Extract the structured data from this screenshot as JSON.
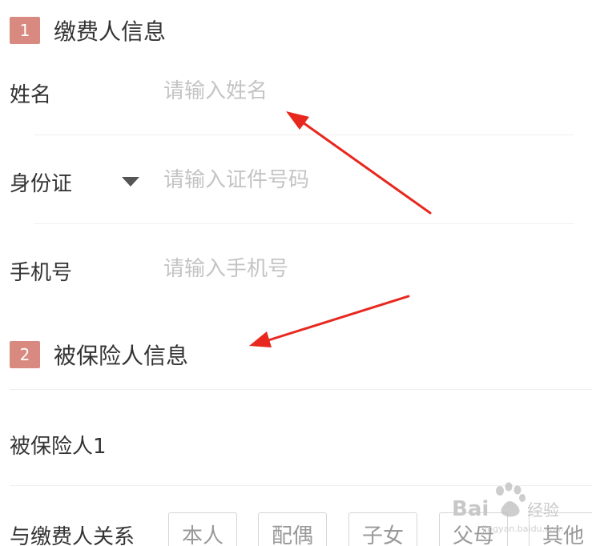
{
  "payer_section": {
    "number": "1",
    "title": "缴费人信息"
  },
  "name_field": {
    "label": "姓名",
    "placeholder": "请输入姓名"
  },
  "id_field": {
    "label": "身份证",
    "placeholder": "请输入证件号码"
  },
  "phone_field": {
    "label": "手机号",
    "placeholder": "请输入手机号"
  },
  "insured_section": {
    "number": "2",
    "title": "被保险人信息"
  },
  "insured_person": {
    "label": "被保险人1"
  },
  "relation": {
    "label": "与缴费人关系",
    "options": [
      "本人",
      "配偶",
      "子女",
      "父母",
      "其他"
    ]
  },
  "watermark": {
    "text": "Baidu经验",
    "url": "jingyan.baidu.com"
  },
  "colors": {
    "badge": "#d98a80",
    "arrow": "#e8281e",
    "placeholder": "#c4c4c4"
  }
}
